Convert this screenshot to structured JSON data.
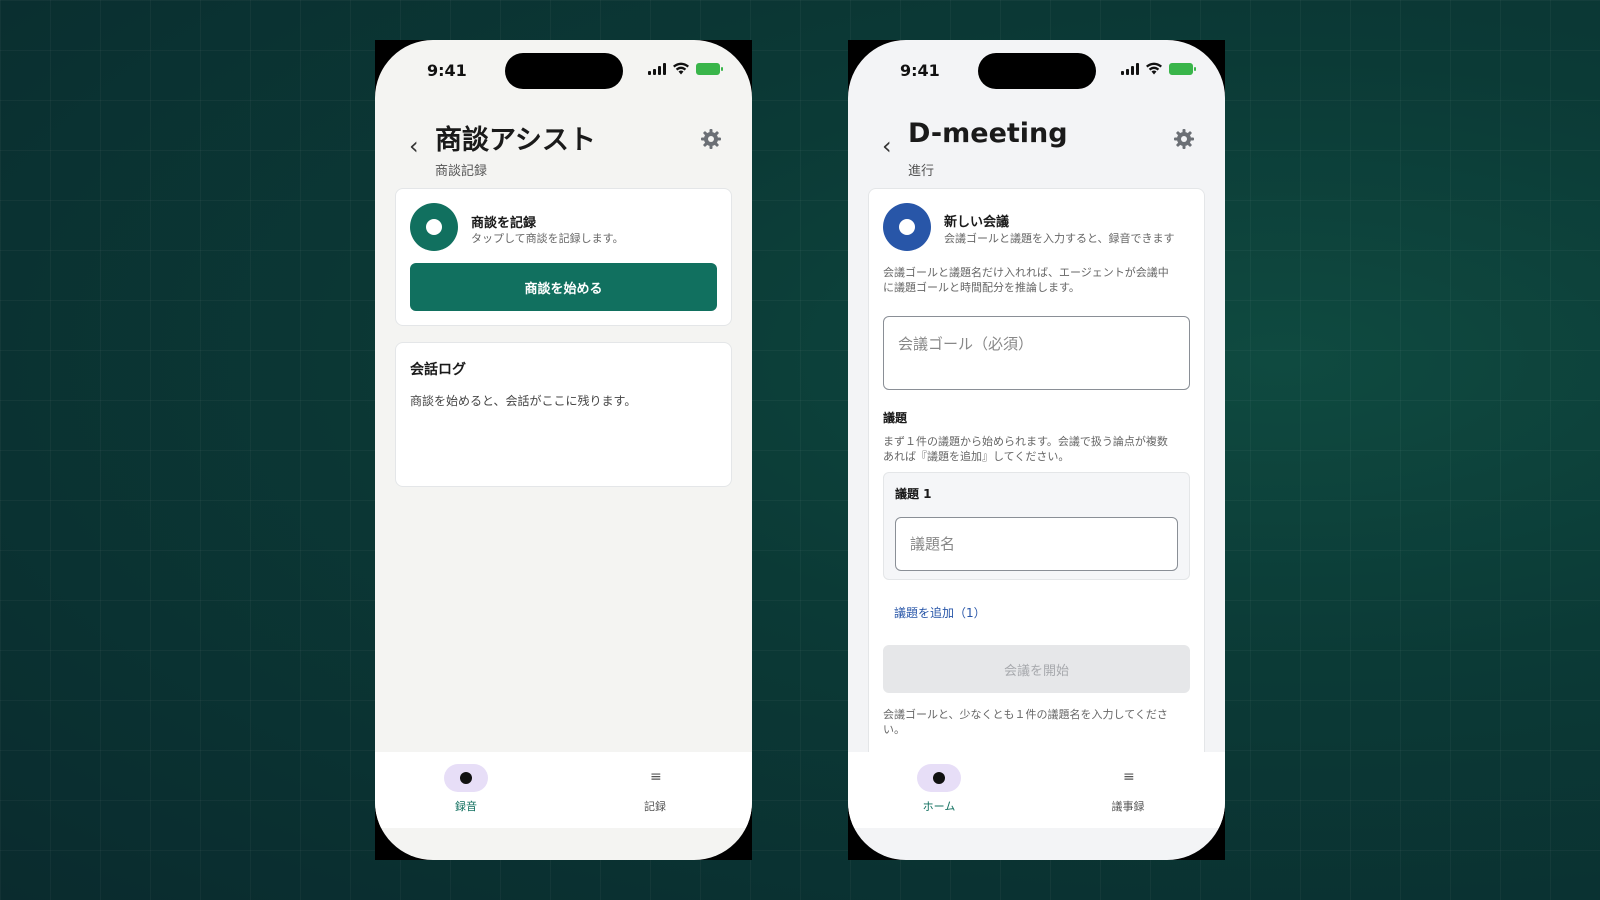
{
  "left_phone": {
    "status": {
      "time": "9:41"
    },
    "header": {
      "title": "商談アシスト",
      "subtitle": "商談記録"
    },
    "record_card": {
      "title": "商談を記録",
      "description": "タップして商談を記録します。",
      "button_label": "商談を始める"
    },
    "log_card": {
      "title": "会話ログ",
      "empty_text": "商談を始めると、会話がここに残ります。"
    },
    "tabs": [
      {
        "label": "録音",
        "icon": "record-dot-icon",
        "active": true
      },
      {
        "label": "記録",
        "icon": "list-icon",
        "active": false
      }
    ]
  },
  "right_phone": {
    "status": {
      "time": "9:41"
    },
    "header": {
      "title": "D-meeting",
      "subtitle": "進行"
    },
    "meeting_card": {
      "title": "新しい会議",
      "description": "会議ゴールと議題を入力すると、録音できます",
      "intro_line1": "会議ゴールと議題名だけ入れれば、エージェントが会議中",
      "intro_line2": "に議題ゴールと時間配分を推論します。",
      "goal_placeholder": "会議ゴール（必須）",
      "agenda_label": "議題",
      "agenda_help_line1": "まず１件の議題から始められます。会議で扱う論点が複数",
      "agenda_help_line2": "あれば『議題を追加』してください。",
      "agenda_item_label": "議題 1",
      "agenda_name_placeholder": "議題名",
      "add_agenda_label": "議題を追加（1）",
      "start_button_label": "会議を開始",
      "footer_line1": "会議ゴールと、少なくとも１件の議題名を入力してくださ",
      "footer_line2": "い。"
    },
    "tabs": [
      {
        "label": "ホーム",
        "icon": "record-dot-icon",
        "active": true
      },
      {
        "label": "議事録",
        "icon": "list-icon",
        "active": false
      }
    ]
  },
  "colors": {
    "accent_green": "#11705f",
    "accent_blue": "#2856a8",
    "tab_active_bg": "#e7def7"
  }
}
